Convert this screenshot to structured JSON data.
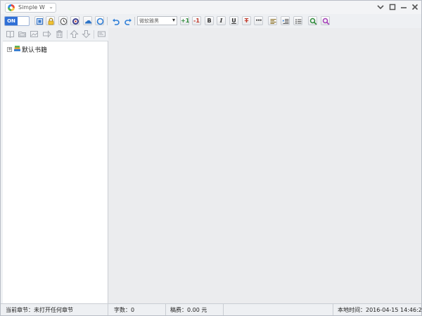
{
  "app": {
    "name": "Simple W",
    "toggle_label": "ON"
  },
  "toolbar": {
    "font": {
      "value": "微软雅黑"
    },
    "font_size_up": "+1",
    "font_size_down": "-1",
    "bold": "B",
    "italic": "I",
    "underline": "U",
    "strike": "T",
    "more": "•••"
  },
  "tree": {
    "items": [
      {
        "label": "默认书籍"
      }
    ]
  },
  "statusbar": {
    "current_chapter": "当前章节：未打开任何章节",
    "word_count": "字数：0",
    "fee": "稿费：0.00 元",
    "local_time": "本地时间：2016-04-15 14:46:21"
  },
  "colors": {
    "accent": "#2f6fd6",
    "editor_bg": "#ebecee"
  }
}
